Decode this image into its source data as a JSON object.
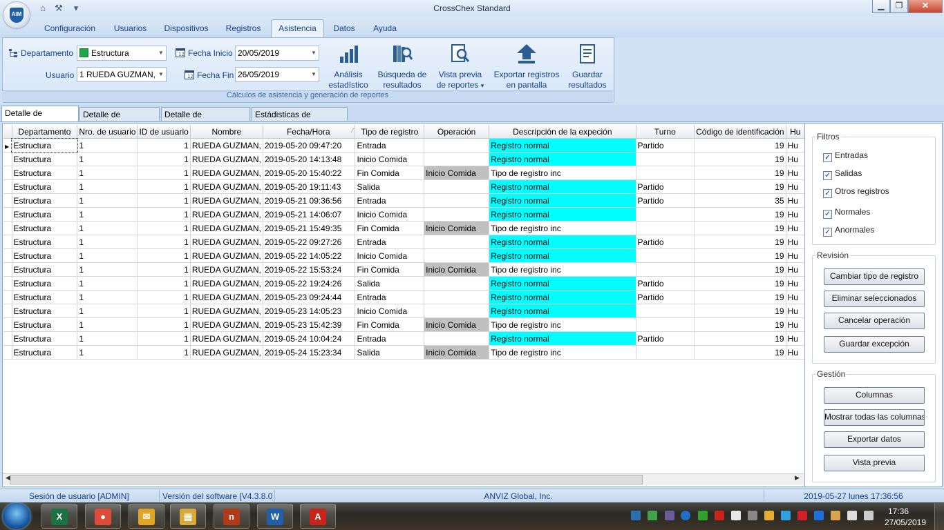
{
  "window": {
    "title": "CrossChex Standard",
    "logo_text": "AIM",
    "controls": {
      "minimize": "▁",
      "maximize": "❐",
      "close": "✕"
    }
  },
  "quick_access": {
    "home": "⌂",
    "tools": "⚒",
    "menu": "▾"
  },
  "ribbon": {
    "tabs": [
      "Configuración",
      "Usuarios",
      "Dispositivos",
      "Registros",
      "Asistencia",
      "Datos",
      "Ayuda"
    ],
    "active_tab": "Asistencia",
    "filters": {
      "departamento_label": "Departamento",
      "departamento_value": "Estructura",
      "usuario_label": "Usuario",
      "usuario_value": "1    RUEDA GUZMAN,",
      "fecha_inicio_label": "Fecha Inicio",
      "fecha_inicio_value": "20/05/2019",
      "fecha_fin_label": "Fecha Fin",
      "fecha_fin_value": "26/05/2019"
    },
    "buttons": {
      "analisis_l1": "Análisis",
      "analisis_l2": "estadístico",
      "busqueda_l1": "Búsqueda de",
      "busqueda_l2": "resultados",
      "vista_l1": "Vista previa",
      "vista_l2": "de reportes",
      "vista_arrow": "▾",
      "exportar_l1": "Exportar registros",
      "exportar_l2": "en pantalla",
      "guardar_l1": "Guardar",
      "guardar_l2": "resultados"
    },
    "group_caption": "Cálculos de asistencia y generación de reportes"
  },
  "subtabs": [
    "Detalle de registros",
    "Detalle de asistencia",
    "Detalle de excepciones",
    "Estádisticas de asistencia"
  ],
  "active_subtab": "Detalle de registros",
  "grid": {
    "columns": [
      "",
      "Departamento",
      "Nro. de usuario",
      "ID de usuario",
      "Nombre",
      "Fecha/Hora",
      "Tipo de registro",
      "Operación",
      "Descripción de la expeción",
      "Turno",
      "Código de identificación",
      "Hu"
    ],
    "sort_indicator": "⁄",
    "row_pointer": "▶",
    "rows": [
      [
        "Estructura",
        "1",
        "1",
        "RUEDA GUZMAN,",
        "2019-05-20 09:47:20",
        "Entrada",
        "",
        "Registro normal",
        "Partido",
        "19",
        "Hu"
      ],
      [
        "Estructura",
        "1",
        "1",
        "RUEDA GUZMAN,",
        "2019-05-20 14:13:48",
        "Inicio Comida",
        "",
        "Registro normal",
        "",
        "19",
        "Hu"
      ],
      [
        "Estructura",
        "1",
        "1",
        "RUEDA GUZMAN,",
        "2019-05-20 15:40:22",
        "Fin Comida",
        "Inicio Comida",
        "Tipo de registro inc",
        "",
        "19",
        "Hu"
      ],
      [
        "Estructura",
        "1",
        "1",
        "RUEDA GUZMAN,",
        "2019-05-20 19:11:43",
        "Salida",
        "",
        "Registro normal",
        "Partido",
        "19",
        "Hu"
      ],
      [
        "Estructura",
        "1",
        "1",
        "RUEDA GUZMAN,",
        "2019-05-21 09:36:56",
        "Entrada",
        "",
        "Registro normal",
        "Partido",
        "35",
        "Hu"
      ],
      [
        "Estructura",
        "1",
        "1",
        "RUEDA GUZMAN,",
        "2019-05-21 14:06:07",
        "Inicio Comida",
        "",
        "Registro normal",
        "",
        "19",
        "Hu"
      ],
      [
        "Estructura",
        "1",
        "1",
        "RUEDA GUZMAN,",
        "2019-05-21 15:49:35",
        "Fin Comida",
        "Inicio Comida",
        "Tipo de registro inc",
        "",
        "19",
        "Hu"
      ],
      [
        "Estructura",
        "1",
        "1",
        "RUEDA GUZMAN,",
        "2019-05-22 09:27:26",
        "Entrada",
        "",
        "Registro normal",
        "Partido",
        "19",
        "Hu"
      ],
      [
        "Estructura",
        "1",
        "1",
        "RUEDA GUZMAN,",
        "2019-05-22 14:05:22",
        "Inicio Comida",
        "",
        "Registro normal",
        "",
        "19",
        "Hu"
      ],
      [
        "Estructura",
        "1",
        "1",
        "RUEDA GUZMAN,",
        "2019-05-22 15:53:24",
        "Fin Comida",
        "Inicio Comida",
        "Tipo de registro inc",
        "",
        "19",
        "Hu"
      ],
      [
        "Estructura",
        "1",
        "1",
        "RUEDA GUZMAN,",
        "2019-05-22 19:24:26",
        "Salida",
        "",
        "Registro normal",
        "Partido",
        "19",
        "Hu"
      ],
      [
        "Estructura",
        "1",
        "1",
        "RUEDA GUZMAN,",
        "2019-05-23 09:24:44",
        "Entrada",
        "",
        "Registro normal",
        "Partido",
        "19",
        "Hu"
      ],
      [
        "Estructura",
        "1",
        "1",
        "RUEDA GUZMAN,",
        "2019-05-23 14:05:23",
        "Inicio Comida",
        "",
        "Registro normal",
        "",
        "19",
        "Hu"
      ],
      [
        "Estructura",
        "1",
        "1",
        "RUEDA GUZMAN,",
        "2019-05-23 15:42:39",
        "Fin Comida",
        "Inicio Comida",
        "Tipo de registro inc",
        "",
        "19",
        "Hu"
      ],
      [
        "Estructura",
        "1",
        "1",
        "RUEDA GUZMAN,",
        "2019-05-24 10:04:24",
        "Entrada",
        "",
        "Registro normal",
        "Partido",
        "19",
        "Hu"
      ],
      [
        "Estructura",
        "1",
        "1",
        "RUEDA GUZMAN,",
        "2019-05-24 15:23:34",
        "Salida",
        "Inicio Comida",
        "Tipo de registro inc",
        "",
        "19",
        "Hu"
      ]
    ],
    "highlight_color": "#00ffff",
    "operation_color": "#c0c0c0",
    "scroll_left": "◀",
    "scroll_right": "▶"
  },
  "filtros": {
    "title": "Filtros",
    "items": [
      {
        "label": "Entradas",
        "checked": "✓"
      },
      {
        "label": "Salidas",
        "checked": "✓"
      },
      {
        "label": "Otros registros",
        "checked": "✓"
      },
      {
        "label": "Normales",
        "checked": "✓"
      },
      {
        "label": "Anormales",
        "checked": "✓"
      }
    ]
  },
  "revision": {
    "title": "Revisión",
    "buttons": [
      "Cambiar tipo de registro",
      "Eliminar seleccionados",
      "Cancelar operación",
      "Guardar excepción"
    ]
  },
  "gestion": {
    "title": "Gestión",
    "buttons": [
      "Columnas",
      "Mostrar todas las columnas",
      "Exportar datos",
      "Vista previa"
    ]
  },
  "status": {
    "sesion": "Sesión de usuario  [ADMIN]",
    "version": "Versión del software  [V4.3.8.0]",
    "company": "ANVIZ Global, Inc.",
    "datetime": "2019-05-27 lunes 17:36:56"
  },
  "taskbar": {
    "apps": [
      {
        "name": "excel",
        "glyph": "X",
        "color": "#1e7145"
      },
      {
        "name": "chrome",
        "glyph": "●",
        "color": "#dd4b39"
      },
      {
        "name": "outlook",
        "glyph": "✉",
        "color": "#e0a526"
      },
      {
        "name": "explorer",
        "glyph": "▤",
        "color": "#d9a93a"
      },
      {
        "name": "app-n",
        "glyph": "n",
        "color": "#b33a18"
      },
      {
        "name": "crosschex",
        "glyph": "W",
        "color": "#2160a8"
      },
      {
        "name": "acrobat",
        "glyph": "A",
        "color": "#c8241c"
      }
    ],
    "clock_time": "17:36",
    "clock_date": "27/05/2019"
  }
}
